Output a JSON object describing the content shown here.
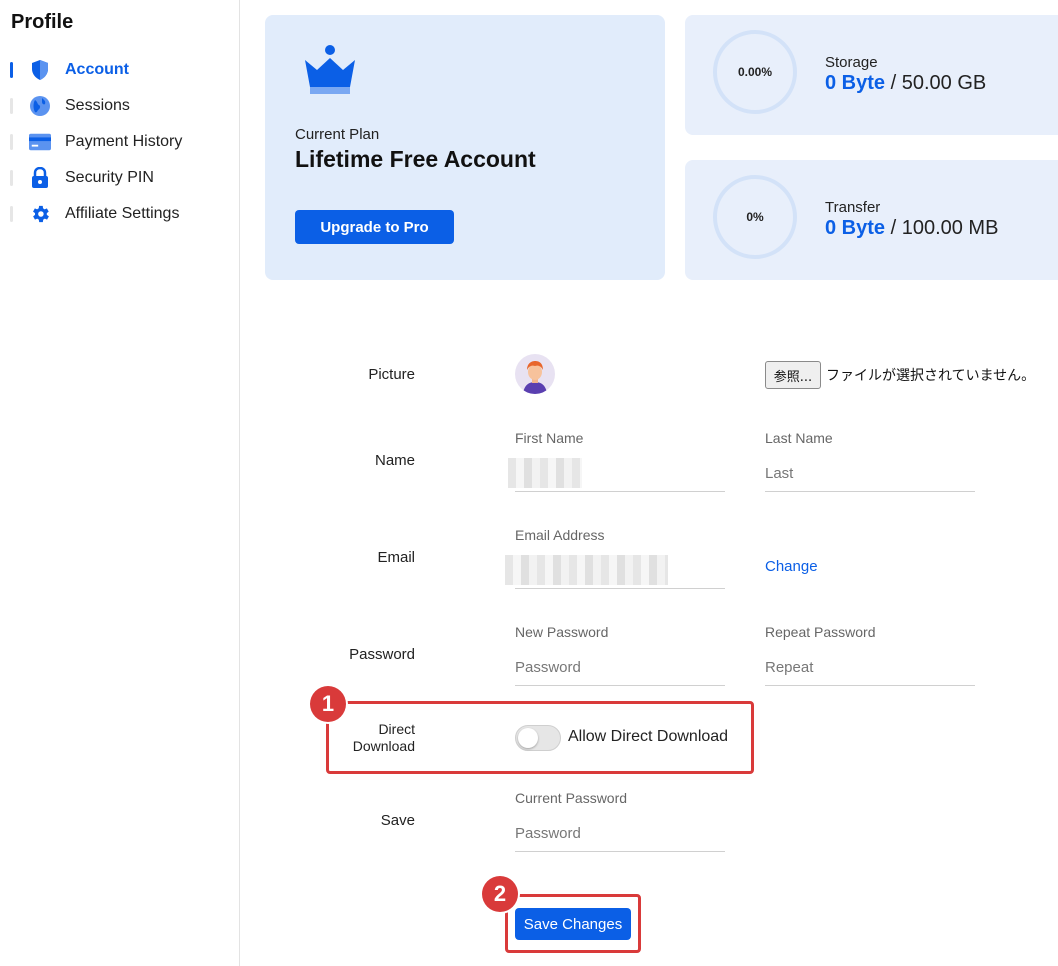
{
  "sidebar": {
    "title": "Profile",
    "items": [
      {
        "label": "Account",
        "icon": "shield-icon",
        "active": true
      },
      {
        "label": "Sessions",
        "icon": "globe-icon",
        "active": false
      },
      {
        "label": "Payment History",
        "icon": "credit-card-icon",
        "active": false
      },
      {
        "label": "Security PIN",
        "icon": "lock-icon",
        "active": false
      },
      {
        "label": "Affiliate Settings",
        "icon": "gear-icon",
        "active": false
      }
    ]
  },
  "plan": {
    "icon": "crown-icon",
    "subtitle": "Current Plan",
    "name": "Lifetime Free Account",
    "upgrade_label": "Upgrade to Pro"
  },
  "storage": {
    "label": "Storage",
    "percent_text": "0.00%",
    "used": "0 Byte",
    "total": "/ 50.00 GB"
  },
  "transfer": {
    "label": "Transfer",
    "percent_text": "0%",
    "used": "0 Byte",
    "total": "/ 100.00 MB"
  },
  "form": {
    "picture": {
      "label": "Picture",
      "file_button": "参照...",
      "file_status": "ファイルが選択されていません。"
    },
    "name": {
      "label": "Name",
      "first_label": "First Name",
      "last_label": "Last Name",
      "last_placeholder": "Last"
    },
    "email": {
      "label": "Email",
      "field_label": "Email Address",
      "change_link": "Change"
    },
    "password": {
      "label": "Password",
      "new_label": "New Password",
      "new_placeholder": "Password",
      "repeat_label": "Repeat Password",
      "repeat_placeholder": "Repeat"
    },
    "direct_download": {
      "label_line1": "Direct",
      "label_line2": "Download",
      "toggle_label": "Allow Direct Download",
      "enabled": false
    },
    "save": {
      "label": "Save",
      "current_label": "Current Password",
      "current_placeholder": "Password",
      "button_label": "Save Changes"
    }
  },
  "annotations": [
    {
      "number": "1"
    },
    {
      "number": "2"
    }
  ],
  "colors": {
    "accent": "#0b5fe6",
    "card_bg": "#e1ecfb",
    "annotation": "#d93a3a"
  }
}
